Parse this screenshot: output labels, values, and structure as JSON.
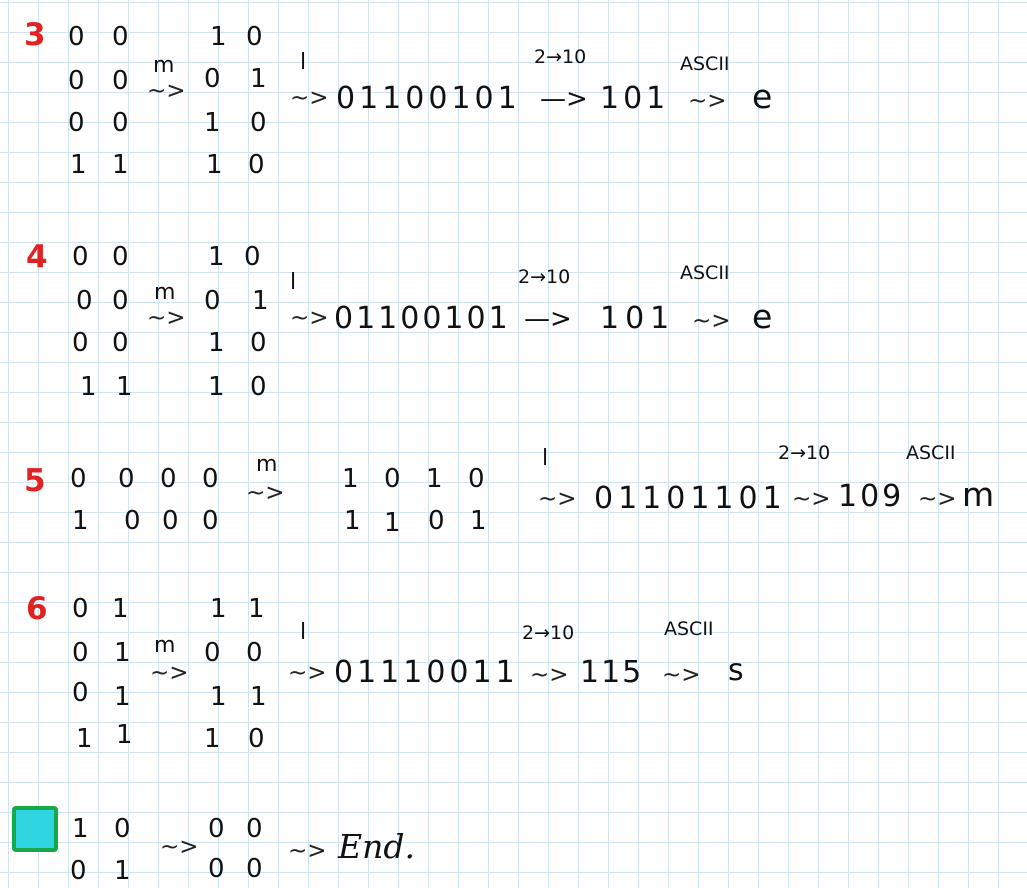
{
  "ops": {
    "m": "m",
    "l": "l",
    "squig": "~>",
    "arrow": "—>",
    "base": "2→10",
    "ascii": "ASCII"
  },
  "steps": [
    {
      "number": "3",
      "left": [
        [
          "0",
          "0"
        ],
        [
          "0",
          "0"
        ],
        [
          "0",
          "0"
        ],
        [
          "1",
          "1"
        ]
      ],
      "right": [
        [
          "1",
          "0"
        ],
        [
          "0",
          "1"
        ],
        [
          "1",
          "0"
        ],
        [
          "1",
          "0"
        ]
      ],
      "binary": "01100101",
      "decimal": "101",
      "char": "e"
    },
    {
      "number": "4",
      "left": [
        [
          "0",
          "0"
        ],
        [
          "0",
          "0"
        ],
        [
          "0",
          "0"
        ],
        [
          "1",
          "1"
        ]
      ],
      "right": [
        [
          "1",
          "0"
        ],
        [
          "0",
          "1"
        ],
        [
          "1",
          "0"
        ],
        [
          "1",
          "0"
        ]
      ],
      "binary": "01100101",
      "decimal": "101",
      "char": "e"
    },
    {
      "number": "5",
      "left": [
        [
          "0",
          "0",
          "0",
          "0"
        ],
        [
          "1",
          "0",
          "0",
          "0"
        ]
      ],
      "right": [
        [
          "1",
          "0",
          "1",
          "0"
        ],
        [
          "1",
          "1",
          "0",
          "1"
        ]
      ],
      "binary": "01101101",
      "decimal": "109",
      "char": "m"
    },
    {
      "number": "6",
      "left": [
        [
          "0",
          "1"
        ],
        [
          "0",
          "1"
        ],
        [
          "0",
          "1"
        ],
        [
          "1",
          "1"
        ]
      ],
      "right": [
        [
          "1",
          "1"
        ],
        [
          "0",
          "0"
        ],
        [
          "1",
          "1"
        ],
        [
          "1",
          "0"
        ]
      ],
      "binary": "01110011",
      "decimal": "115",
      "char": "s"
    }
  ],
  "final": {
    "left": [
      [
        "1",
        "0"
      ],
      [
        "0",
        "1"
      ]
    ],
    "right": [
      [
        "0",
        "0"
      ],
      [
        "0",
        "0"
      ]
    ],
    "end": "End."
  },
  "colors": {
    "step_number": "#e02222",
    "box_fill": "#2fd6e2",
    "box_border": "#17a84a",
    "grid": "#cfe3f1"
  }
}
